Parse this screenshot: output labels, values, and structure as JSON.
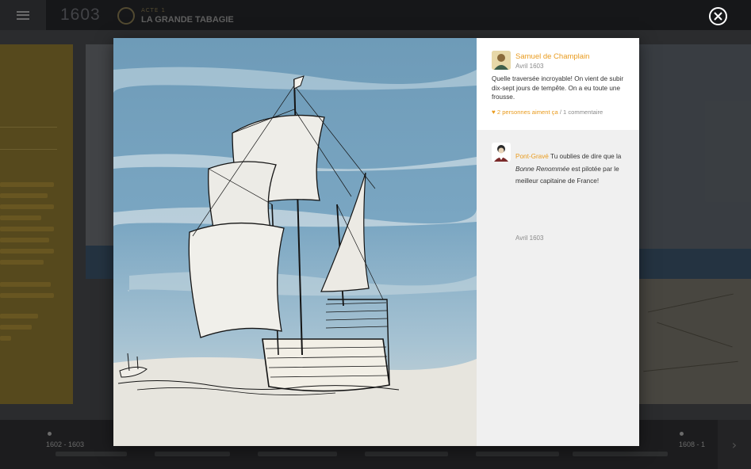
{
  "header": {
    "year": "1603",
    "act_kicker": "ACTE 1",
    "act_title": "LA GRANDE TABAGIE",
    "menu_icon": "hamburger-icon"
  },
  "timeline": {
    "start_label": "1602 - 1603",
    "end_label": "1608 - 1",
    "next_icon": "chevron-right-icon"
  },
  "modal": {
    "close_icon": "close-icon",
    "image_subject": "sailing-ship-illustration",
    "post": {
      "author": "Samuel de Champlain",
      "date": "Avril 1603",
      "text": "Quelle traversée incroyable! On vient de subir dix-sept jours de tempête. On a eu toute une frousse.",
      "likes": "2 personnes aiment ça",
      "separator": " / ",
      "comment_count": "1 commentaire"
    },
    "comments": [
      {
        "author": "Pont-Gravé",
        "text_before": " Tu oublies de dire que la ",
        "text_italic": "Bonne Renommée",
        "text_after": " est pilotée par le meilleur capitaine de France!",
        "date": "Avril 1603"
      }
    ]
  },
  "colors": {
    "accent": "#e99b1e",
    "comment_bg": "#f0f0f0",
    "topbar": "#1d1e20"
  }
}
